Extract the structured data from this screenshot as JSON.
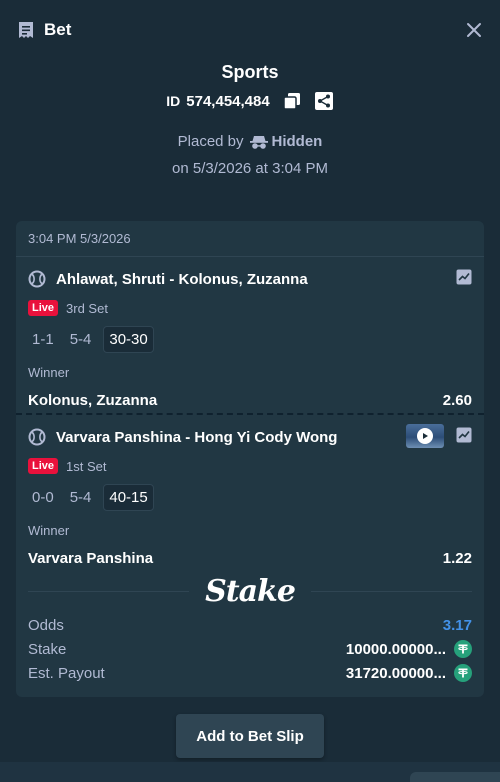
{
  "header": {
    "title": "Bet"
  },
  "summary": {
    "sport": "Sports",
    "id_label": "ID",
    "id_value": "574,454,484",
    "placed_by_label": "Placed by",
    "user": "Hidden",
    "placed_on": "on 5/3/2026 at 3:04 PM"
  },
  "card": {
    "timestamp": "3:04 PM 5/3/2026",
    "legs": [
      {
        "match": "Ahlawat, Shruti - Kolonus, Zuzanna",
        "live": "Live",
        "set": "3rd Set",
        "set_score": "1-1",
        "game_score": "5-4",
        "point_score": "30-30",
        "market": "Winner",
        "pick": "Kolonus, Zuzanna",
        "odds": "2.60"
      },
      {
        "match": "Varvara Panshina - Hong Yi Cody Wong",
        "live": "Live",
        "set": "1st Set",
        "set_score": "0-0",
        "game_score": "5-4",
        "point_score": "40-15",
        "market": "Winner",
        "pick": "Varvara Panshina",
        "odds": "1.22"
      }
    ],
    "brand": "Stake",
    "totals": {
      "odds_label": "Odds",
      "odds_value": "3.17",
      "stake_label": "Stake",
      "stake_value": "10000.00000...",
      "payout_label": "Est. Payout",
      "payout_value": "31720.00000..."
    }
  },
  "actions": {
    "add_to_slip": "Add to Bet Slip"
  },
  "colors": {
    "live": "#e9113c",
    "accent": "#4391e7",
    "tether": "#26a17b"
  },
  "icons": [
    "bet-slip-icon",
    "close-icon",
    "copy-icon",
    "share-icon",
    "incognito-icon",
    "tennis-ball-icon",
    "stats-icon",
    "play-icon",
    "tether-icon"
  ]
}
